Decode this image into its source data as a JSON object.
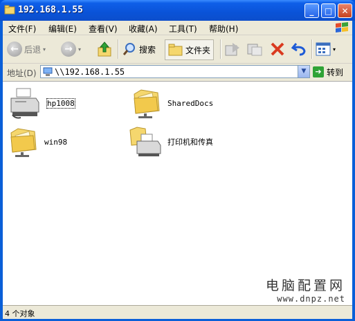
{
  "window": {
    "title": "192.168.1.55"
  },
  "menu": [
    "文件(F)",
    "编辑(E)",
    "查看(V)",
    "收藏(A)",
    "工具(T)",
    "帮助(H)"
  ],
  "toolbar": {
    "back_label": "后退",
    "search_label": "搜索",
    "folders_label": "文件夹"
  },
  "address": {
    "label": "地址(D)",
    "value": "\\\\192.168.1.55",
    "go_label": "转到"
  },
  "items": [
    {
      "label": "hp1008",
      "icon": "printer-icon"
    },
    {
      "label": "SharedDocs",
      "icon": "shared-folder-icon"
    },
    {
      "label": "win98",
      "icon": "shared-folder-icon"
    },
    {
      "label": "打印机和传真",
      "icon": "printers-folder-icon"
    }
  ],
  "status": {
    "text": "4 个对象"
  },
  "watermark": {
    "line1": "电脑配置网",
    "line2": "www.dnpz.net"
  },
  "colors": {
    "titlebar": "#0a53d8",
    "folder": "#f5d76e",
    "go": "#2fa336",
    "delete": "#d93a1f",
    "undo": "#1e5bd6"
  }
}
